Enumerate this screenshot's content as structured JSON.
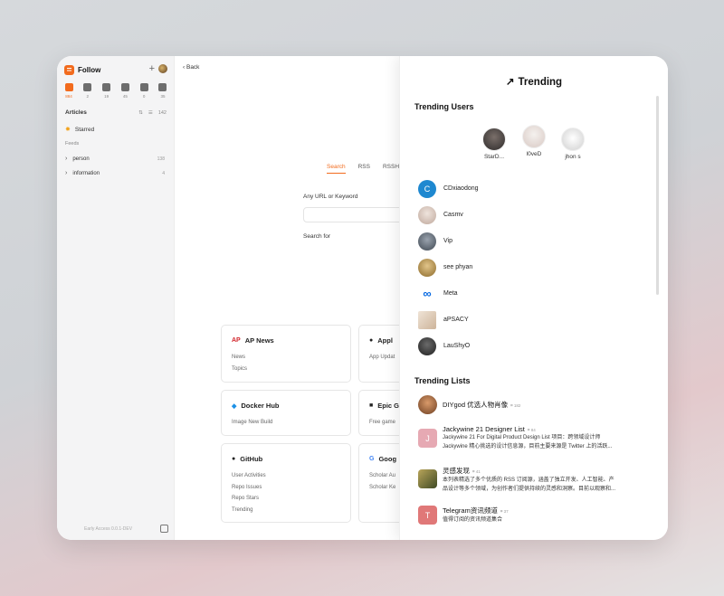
{
  "sidebar": {
    "app_title": "Follow",
    "views": [
      {
        "icon": "article-icon",
        "count": "884",
        "active": true
      },
      {
        "icon": "twitter-icon",
        "count": "2"
      },
      {
        "icon": "image-icon",
        "count": "19"
      },
      {
        "icon": "video-icon",
        "count": "45"
      },
      {
        "icon": "audio-icon",
        "count": "0"
      },
      {
        "icon": "notification-icon",
        "count": "35"
      }
    ],
    "section_title": "Articles",
    "section_count": "142",
    "starred_label": "Starred",
    "feeds_label": "Feeds",
    "feeds": [
      {
        "label": "person",
        "count": "138"
      },
      {
        "label": "information",
        "count": "4"
      }
    ],
    "footer": "Early Access 0.0.1-DEV"
  },
  "main": {
    "back_label": "Back",
    "tabs": [
      "Search",
      "RSS",
      "RSSH"
    ],
    "url_label": "Any URL or Keyword",
    "search_for_label": "Search for",
    "cards": [
      {
        "icon": "AP",
        "title": "AP News",
        "lines": [
          "News",
          "Topics"
        ]
      },
      {
        "icon": "",
        "title": "Appl",
        "lines": [
          "App Updat"
        ]
      },
      {
        "icon": "docker-icon",
        "title": "Docker Hub",
        "lines": [
          "Image New Build"
        ]
      },
      {
        "icon": "epic-icon",
        "title": "Epic G",
        "lines": [
          "Free game"
        ]
      },
      {
        "icon": "github-icon",
        "title": "GitHub",
        "lines": [
          "User Activities",
          "Repo Issues",
          "Repo Stars",
          "Trending"
        ]
      },
      {
        "icon": "G",
        "title": "Goog",
        "lines": [
          "Scholar Au",
          "Scholar Ke"
        ]
      }
    ]
  },
  "trending": {
    "title": "Trending",
    "users_heading": "Trending Users",
    "top_users": [
      {
        "name": "StarD..."
      },
      {
        "name": "l0veD"
      },
      {
        "name": "jhon s"
      }
    ],
    "users": [
      {
        "name": "CDxiaodong",
        "initial": "C",
        "color": "#1e88d0"
      },
      {
        "name": "Casmv",
        "initial": "",
        "color": "#cdb7ad"
      },
      {
        "name": "Vip",
        "initial": "",
        "color": "#5c6a7a"
      },
      {
        "name": "see phyan",
        "initial": "",
        "color": "#c9a24f"
      },
      {
        "name": "Meta",
        "initial": "∞",
        "color": "#ffffff"
      },
      {
        "name": "aPSACY",
        "initial": "",
        "color": "#e0cfbf"
      },
      {
        "name": "LauShyO",
        "initial": "",
        "color": "#3a3a3a"
      }
    ],
    "lists_heading": "Trending Lists",
    "lists": [
      {
        "title": "DIYgod 优选人物肖像",
        "count": "182",
        "desc": [],
        "initial": "",
        "color": "#a9673b"
      },
      {
        "title": "Jackywine 21 Designer List",
        "count": "84",
        "desc": [
          "Jackywine 21 For Digital Product Design List 项目：跨领域设计师",
          "Jackywine 精心挑选的设计信息源，目前主要来源是 Twitter 上的活跃..."
        ],
        "initial": "J",
        "color": "#e6a9b3"
      },
      {
        "title": "灵感发现",
        "count": "41",
        "desc": [
          "本列表精选了多个优质的 RSS 订阅源，涵盖了独立开发、人工智能、产",
          "品设计等多个领域，为创作者们提供持续的灵感和洞察。目前以观察和..."
        ],
        "initial": "",
        "color": "#6f7340"
      },
      {
        "title": "Telegram资讯频道",
        "count": "37",
        "desc": [
          "值得订阅的资讯频道集合"
        ],
        "initial": "T",
        "color": "#e07878"
      }
    ]
  }
}
